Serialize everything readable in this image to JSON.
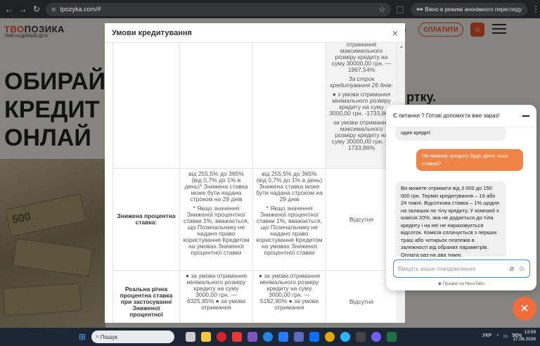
{
  "browser": {
    "url": "tpozyka.com/#",
    "incognito_label": "Вікно в режимі анонімного перегляду"
  },
  "site": {
    "logo_part1": "ТВО",
    "logo_part2": "ПОЗИКА",
    "logo_tagline": "ТВІЙ НАДІЙНИЙ ДРУГ",
    "pay_button": "СПЛАТИТИ",
    "hero_lines": [
      "ОБИРАЙ",
      "КРЕДИТ",
      "ОНЛАЙ"
    ],
    "right_text": "ртку.",
    "money_label": "500"
  },
  "modal": {
    "title": "Умови кредитування",
    "close": "×",
    "top_row": {
      "col3": [
        "отримання максимального розміру кредиту на суму 30000,00 грн. — 1967,54%",
        "За строк кредитування 26 днів:",
        "● з умови отримання мінімального розміру кредиту на суму 3000,00 грн. -1733,86%",
        "за умови отримання максимального розміру кредиту на суму 30000,00 грн. — 1733,86%"
      ]
    },
    "reduced_rate_row": {
      "label": "Знижена процентна ставка:",
      "col1_a": "від 255,5% до 365% (від 0,7% до 1% в день)* Знижена ставка може бути надана строком на 29 днів",
      "col1_b": "* Якщо значення Зниженої процентної ставки 1%, вважається, що Позичальнику не надано право користування Кредитом на умовах Зниженої процентної ставки",
      "col2_a": "від 255,5% до 365% (від 0,7% до 1% в день) Знижена ставка може бути надана строком на 29 днів",
      "col2_b": "* Якщо значення Зниженої процентної ставки 1%, вважається, що Позичальнику не надано право користування Кредитом на умовах Зниженої процентної ставки",
      "col3": "Відсутня"
    },
    "real_rate_row": {
      "label": "Реальна річна процентна ставка при застосуванні Зниженої процентної",
      "col1": "● за умови отримання мінімального розміру кредиту на суму 3000,00 грн. — 6325,85% ● за умови отримання",
      "col2": "● за умови отримання мінімального розміру кредиту на суму 3000,00 грн. — 5182,90% ● за умови отримання",
      "col3": "Відсутня"
    }
  },
  "chat": {
    "header": "Є питання ? Готові допомогти вже зараз!",
    "msg_op1": "один кредит.",
    "msg_me": "По новому кредиту буде діяти інша ставка?",
    "msg_op2": "Ви можете отримати від 3 000 до 150 000 грн. Термін кредитування – 16 або 24 тижні. Відсоткова ставка – 1% щодня на залишок по тілу кредиту. У компанії є комісія 20%, яка не додається до тіла кредиту і на неї не нараховується відсоток. Комісія сплачується з перших траш або чотирьох платежів в залежності від обраних параметрів. Оплата раз на два тижні.",
    "input_placeholder": "Введіть ваше повідомлення",
    "footer": "Працює на NovaTalks"
  },
  "taskbar": {
    "search_label": "Пошук",
    "lang": "УКР",
    "battery": "96%",
    "time": "13:59",
    "date": "17.06.2026"
  }
}
